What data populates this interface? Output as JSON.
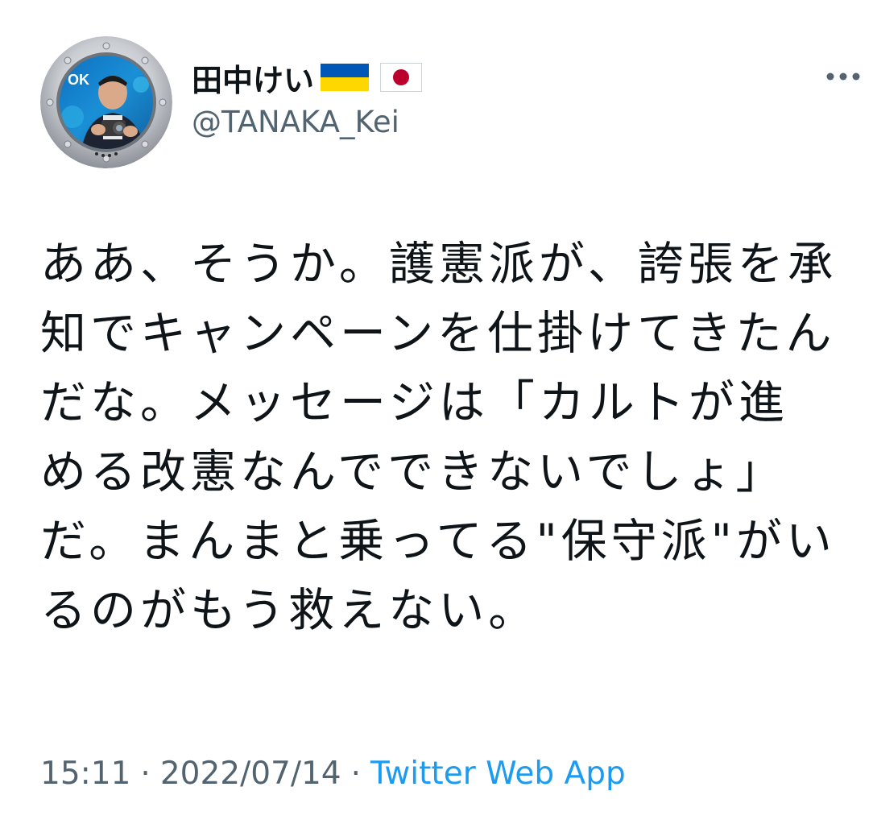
{
  "tweet": {
    "author": {
      "display_name": "田中けい",
      "flags": [
        "ukraine-flag-icon",
        "japan-flag-icon"
      ],
      "handle": "@TANAKA_Kei",
      "avatar_text": "OK"
    },
    "text": "ああ、そうか。護憲派が、誇張を承知でキャンペーンを仕掛けてきたんだな。メッセージは「カルトが進める改憲なんでできないでしょ」だ。まんまと乗ってる\"保守派\"がいるのがもう救えない。",
    "time": "15:11",
    "separator": "·",
    "date": "2022/07/14",
    "source": "Twitter Web App"
  },
  "colors": {
    "text_primary": "#0f1419",
    "text_secondary": "#536471",
    "link": "#1d9bf0",
    "background": "#ffffff"
  },
  "icons": {
    "more": "more-options-icon"
  }
}
